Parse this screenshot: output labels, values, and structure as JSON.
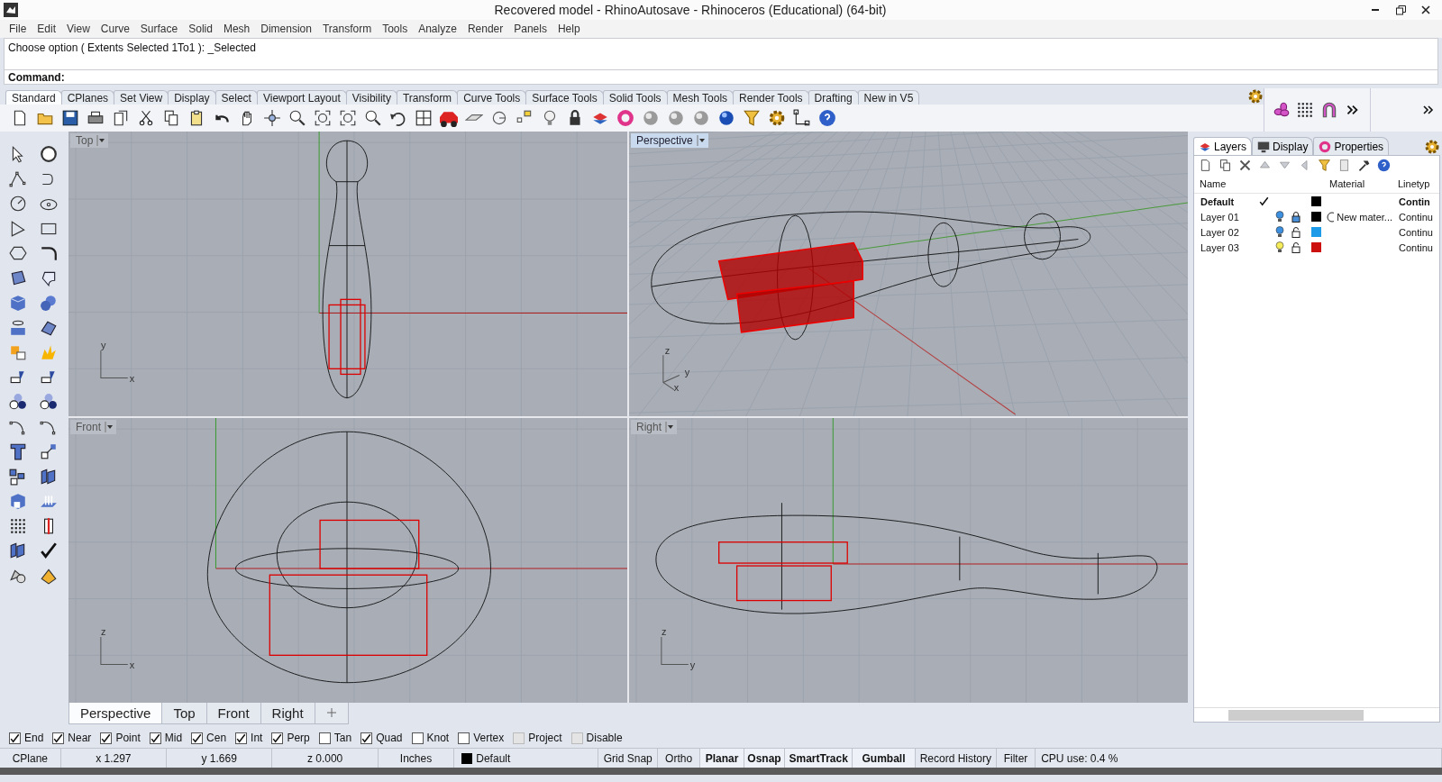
{
  "window": {
    "title": "Recovered model - RhinoAutosave - Rhinoceros (Educational) (64-bit)"
  },
  "menu": [
    "File",
    "Edit",
    "View",
    "Curve",
    "Surface",
    "Solid",
    "Mesh",
    "Dimension",
    "Transform",
    "Tools",
    "Analyze",
    "Render",
    "Panels",
    "Help"
  ],
  "command": {
    "history": "Choose option ( Extents  Selected  1To1 ): _Selected",
    "prompt": "Command:"
  },
  "toolbar_tabs": [
    {
      "label": "Standard",
      "selected": true
    },
    {
      "label": "CPlanes",
      "selected": false
    },
    {
      "label": "Set View",
      "selected": false
    },
    {
      "label": "Display",
      "selected": false
    },
    {
      "label": "Select",
      "selected": false
    },
    {
      "label": "Viewport Layout",
      "selected": false
    },
    {
      "label": "Visibility",
      "selected": false
    },
    {
      "label": "Transform",
      "selected": false
    },
    {
      "label": "Curve Tools",
      "selected": false
    },
    {
      "label": "Surface Tools",
      "selected": false
    },
    {
      "label": "Solid Tools",
      "selected": false
    },
    {
      "label": "Mesh Tools",
      "selected": false
    },
    {
      "label": "Render Tools",
      "selected": false
    },
    {
      "label": "Drafting",
      "selected": false
    },
    {
      "label": "New in V5",
      "selected": false
    }
  ],
  "viewports": [
    {
      "label": "Top",
      "selected": false,
      "kind": "top",
      "axis_labels": [
        "y",
        "x"
      ]
    },
    {
      "label": "Perspective",
      "selected": true,
      "kind": "perspective",
      "axis_labels": [
        "z",
        "y",
        "x"
      ]
    },
    {
      "label": "Front",
      "selected": false,
      "kind": "front",
      "axis_labels": [
        "z",
        "x"
      ]
    },
    {
      "label": "Right",
      "selected": false,
      "kind": "right",
      "axis_labels": [
        "z",
        "y"
      ]
    }
  ],
  "viewport_tabs": [
    {
      "label": "Perspective",
      "selected": true
    },
    {
      "label": "Top",
      "selected": false
    },
    {
      "label": "Front",
      "selected": false
    },
    {
      "label": "Right",
      "selected": false
    }
  ],
  "panel": {
    "tabs": [
      {
        "label": "Layers",
        "selected": true
      },
      {
        "label": "Display",
        "selected": false
      },
      {
        "label": "Properties",
        "selected": false
      }
    ],
    "columns": [
      "Name",
      "Material",
      "Linetyp"
    ],
    "layers": [
      {
        "name": "Default",
        "current": true,
        "color": "#000000",
        "linetype": "Contin"
      },
      {
        "name": "Layer 01",
        "current": false,
        "lit": false,
        "locked": true,
        "color": "#000000",
        "material": "New mater...",
        "linetype": "Continu"
      },
      {
        "name": "Layer 02",
        "current": false,
        "lit": false,
        "locked": false,
        "color": "#1e9be8",
        "linetype": "Continu"
      },
      {
        "name": "Layer 03",
        "current": false,
        "lit": true,
        "locked": false,
        "color": "#cc1010",
        "linetype": "Continu"
      }
    ]
  },
  "osnaps": [
    {
      "label": "End",
      "checked": true,
      "disabled": false
    },
    {
      "label": "Near",
      "checked": true,
      "disabled": false
    },
    {
      "label": "Point",
      "checked": true,
      "disabled": false
    },
    {
      "label": "Mid",
      "checked": true,
      "disabled": false
    },
    {
      "label": "Cen",
      "checked": true,
      "disabled": false
    },
    {
      "label": "Int",
      "checked": true,
      "disabled": false
    },
    {
      "label": "Perp",
      "checked": true,
      "disabled": false
    },
    {
      "label": "Tan",
      "checked": false,
      "disabled": false
    },
    {
      "label": "Quad",
      "checked": true,
      "disabled": false
    },
    {
      "label": "Knot",
      "checked": false,
      "disabled": false
    },
    {
      "label": "Vertex",
      "checked": false,
      "disabled": false
    },
    {
      "label": "Project",
      "checked": false,
      "disabled": true
    },
    {
      "label": "Disable",
      "checked": false,
      "disabled": true
    }
  ],
  "status_bar": [
    {
      "label": "CPlane",
      "on": false,
      "kind": "text"
    },
    {
      "label": "x 1.297",
      "on": false,
      "kind": "text"
    },
    {
      "label": "y 1.669",
      "on": false,
      "kind": "text"
    },
    {
      "label": "z 0.000",
      "on": false,
      "kind": "text"
    },
    {
      "label": "Inches",
      "on": false,
      "kind": "text"
    },
    {
      "label": "Default",
      "on": false,
      "kind": "layer"
    },
    {
      "label": "Grid Snap",
      "on": false,
      "kind": "toggle"
    },
    {
      "label": "Ortho",
      "on": false,
      "kind": "toggle"
    },
    {
      "label": "Planar",
      "on": true,
      "kind": "toggle"
    },
    {
      "label": "Osnap",
      "on": true,
      "kind": "toggle"
    },
    {
      "label": "SmartTrack",
      "on": true,
      "kind": "toggle"
    },
    {
      "label": "Gumball",
      "on": true,
      "kind": "toggle"
    },
    {
      "label": "Record History",
      "on": false,
      "kind": "toggle"
    },
    {
      "label": "Filter",
      "on": false,
      "kind": "toggle"
    },
    {
      "label": "CPU use: 0.4 %",
      "on": false,
      "kind": "wide"
    }
  ]
}
